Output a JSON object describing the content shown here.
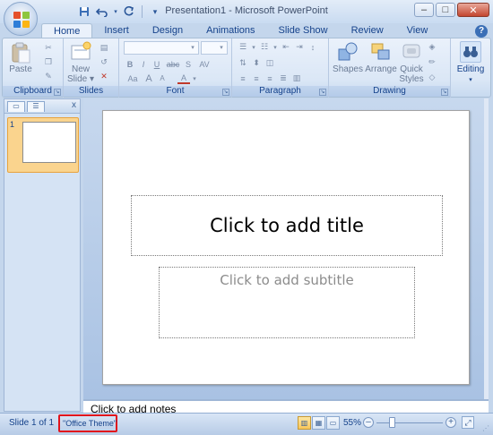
{
  "window": {
    "title": "Presentation1 - Microsoft PowerPoint",
    "controls": {
      "minimize": "–",
      "maximize": "□",
      "close": "✕"
    }
  },
  "quick_access": {
    "save_icon": "save-icon",
    "undo_icon": "undo-icon",
    "redo_icon": "redo-icon",
    "customize_icon": "customize-qat-icon"
  },
  "tabs": [
    {
      "label": "Home",
      "active": true
    },
    {
      "label": "Insert"
    },
    {
      "label": "Design"
    },
    {
      "label": "Animations"
    },
    {
      "label": "Slide Show"
    },
    {
      "label": "Review"
    },
    {
      "label": "View"
    }
  ],
  "ribbon": {
    "groups": {
      "clipboard": {
        "label": "Clipboard",
        "paste": "Paste"
      },
      "slides": {
        "label": "Slides",
        "new_slide_line1": "New",
        "new_slide_line2": "Slide ▾"
      },
      "font": {
        "label": "Font",
        "bold": "B",
        "italic": "I",
        "underline": "U",
        "strike": "abc",
        "shadow": "S",
        "spacing": "AV",
        "case": "Aa",
        "grow": "A",
        "shrink": "A",
        "color": "A"
      },
      "paragraph": {
        "label": "Paragraph"
      },
      "drawing": {
        "label": "Drawing",
        "shapes": "Shapes",
        "arrange": "Arrange",
        "quick_styles_line1": "Quick",
        "quick_styles_line2": "Styles ▾"
      },
      "editing": {
        "label": "Editing"
      }
    }
  },
  "left_panel": {
    "slide_number": "1",
    "close": "x"
  },
  "slide": {
    "title_placeholder": "Click to add title",
    "subtitle_placeholder": "Click to add subtitle"
  },
  "notes": {
    "placeholder": "Click to add notes"
  },
  "status_bar": {
    "slide_info": "Slide 1 of 1",
    "theme": "\"Office Theme\"",
    "zoom": "55%",
    "zoom_level": 0.55
  }
}
